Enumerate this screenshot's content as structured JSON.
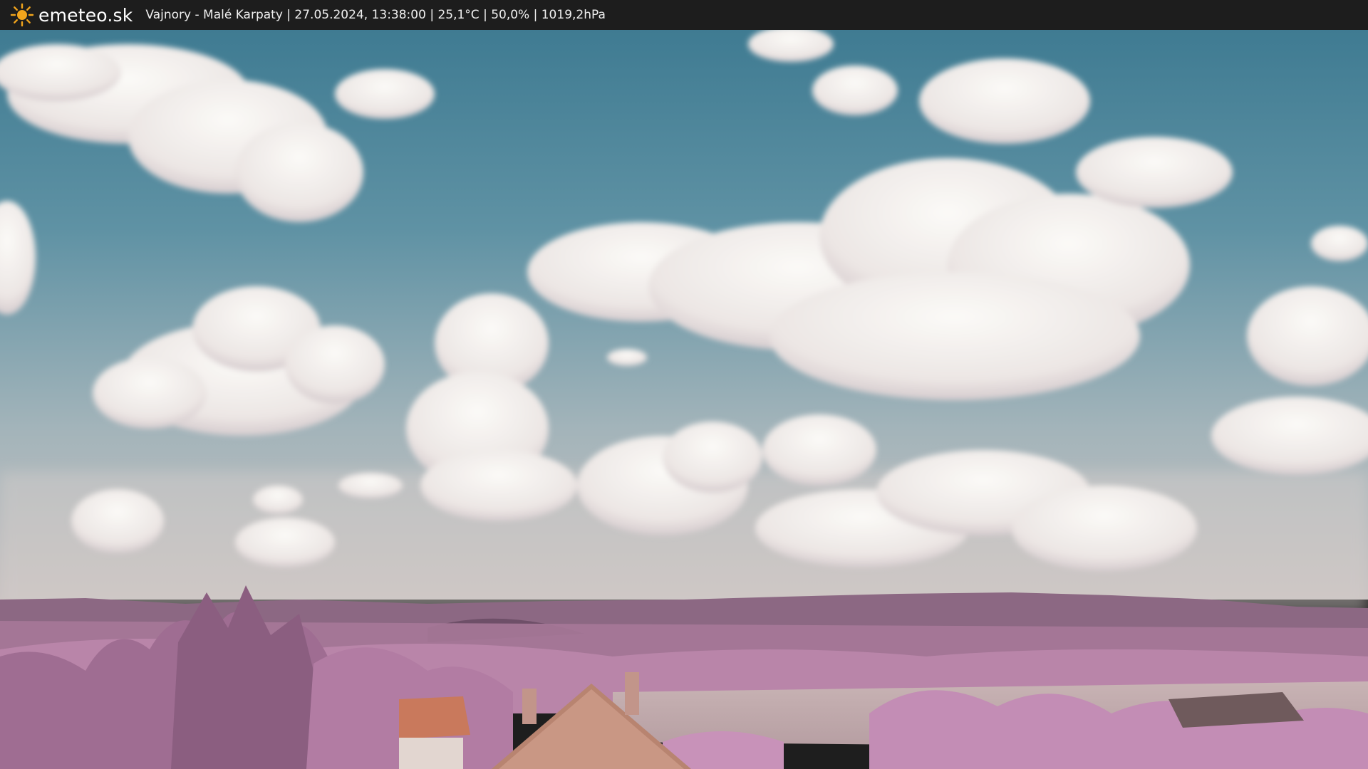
{
  "header": {
    "brand": "emeteo.sk",
    "info": "Vajnory - Malé Karpaty | 27.05.2024, 13:38:00 | 25,1°C | 50,0% | 1019,2hPa",
    "logo_icon": "sun-icon"
  },
  "scene": {
    "sky_top": "#3f7b92",
    "sky_mid": "#6b95a6",
    "sky_haze": "#b3b3b3",
    "cloud_color": "#f3f0ee",
    "hill_color": "#9b6f8f",
    "foliage_color": "#c28bb4",
    "field_color": "#c4aeb1",
    "roof_color": "#c9795c"
  }
}
